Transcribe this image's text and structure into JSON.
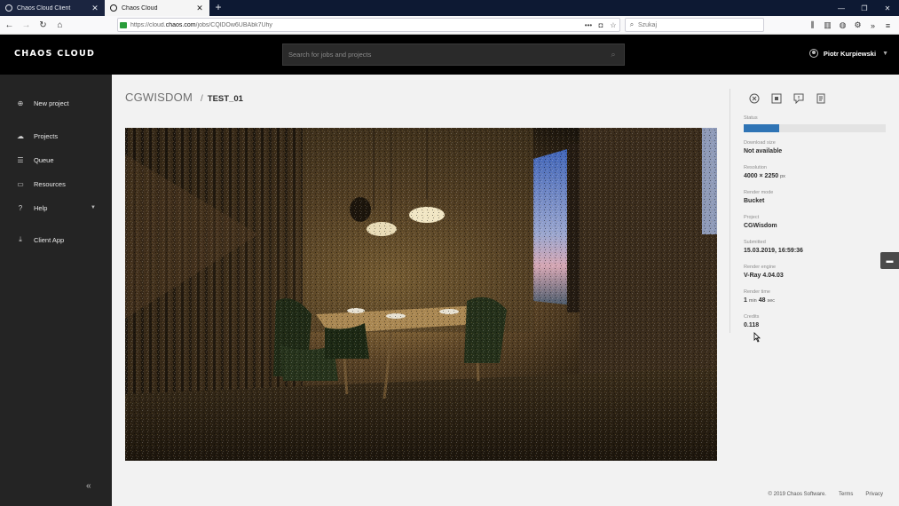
{
  "browser": {
    "tabs": [
      {
        "title": "Chaos Cloud Client",
        "active": false
      },
      {
        "title": "Chaos Cloud",
        "active": true
      }
    ],
    "url_prefix": "https://cloud.",
    "url_domain": "chaos.com",
    "url_path": "/jobs/CQlDOw6UBAbk7Uhy",
    "search_placeholder": "Szukaj"
  },
  "header": {
    "logo": "CHAOS CLOUD",
    "search_placeholder": "Search for jobs and projects",
    "user_name": "Piotr Kurpiewski"
  },
  "sidebar": {
    "items": [
      {
        "label": "New project",
        "icon": "plus-circle-icon"
      },
      {
        "label": "Projects",
        "icon": "cloud-icon"
      },
      {
        "label": "Queue",
        "icon": "sliders-icon"
      },
      {
        "label": "Resources",
        "icon": "card-icon"
      },
      {
        "label": "Help",
        "icon": "question-icon"
      },
      {
        "label": "Client App",
        "icon": "download-icon"
      }
    ],
    "collapse": "«"
  },
  "breadcrumb": {
    "project": "CGWISDOM",
    "separator": "/",
    "job": "TEST_01"
  },
  "job_info": {
    "status_label": "Status",
    "status_progress": 0.25,
    "download_label": "Download size",
    "download_value": "Not available",
    "resolution_label": "Resolution",
    "resolution_value": "4000 × 2250",
    "resolution_unit": "px",
    "render_mode_label": "Render mode",
    "render_mode_value": "Bucket",
    "project_label": "Project",
    "project_value": "CGWisdom",
    "submitted_label": "Submitted",
    "submitted_value": "15.03.2019, 16:59:36",
    "engine_label": "Render engine",
    "engine_value": "V-Ray 4.04.03",
    "time_label": "Render time",
    "time_minutes": "1",
    "time_min_unit": "min",
    "time_seconds": "48",
    "time_sec_unit": "sec",
    "credits_label": "Credits",
    "credits_value": "0.118"
  },
  "footer": {
    "copyright": "© 2019 Chaos Software.",
    "terms": "Terms",
    "privacy": "Privacy"
  },
  "colors": {
    "accent": "#2f74b5",
    "sidebar": "#242424",
    "header": "#000000"
  }
}
